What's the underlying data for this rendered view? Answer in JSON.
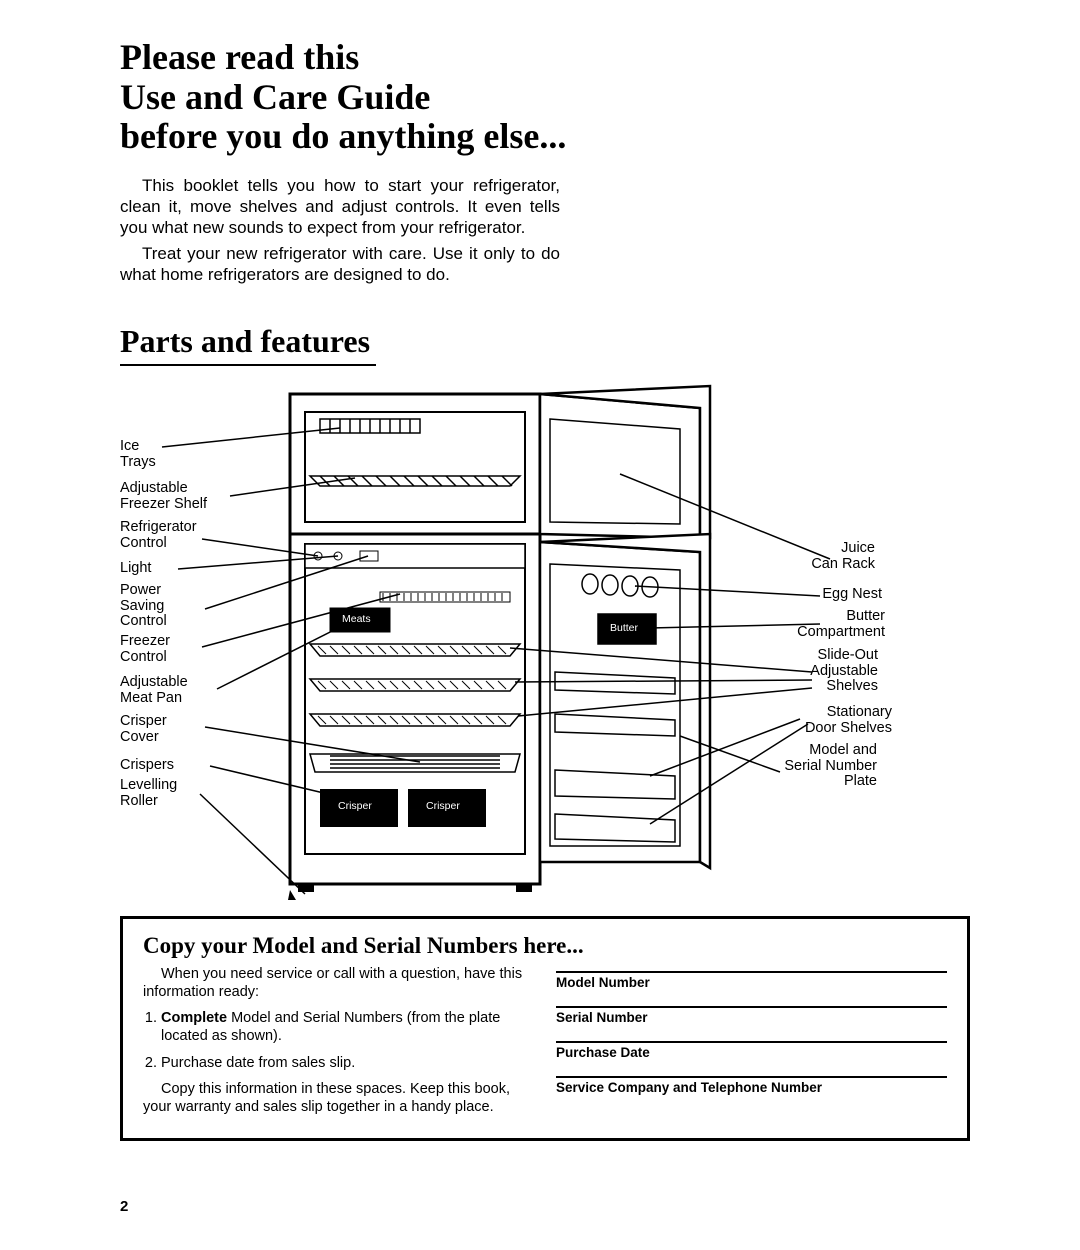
{
  "title_l1": "Please read this",
  "title_l2": "Use and Care Guide",
  "title_l3": "before you do anything else...",
  "intro_p1": "This booklet tells you how to start your refrigerator, clean it, move shelves and adjust controls. It even tells you what new sounds to expect from your refrigerator.",
  "intro_p2": "Treat your new refrigerator with care. Use it only to do what home refrigerators are designed to do.",
  "parts_heading": "Parts and features",
  "labels_left": {
    "ice_trays_l1": "Ice",
    "ice_trays_l2": "Trays",
    "adj_freezer_l1": "Adjustable",
    "adj_freezer_l2": "Freezer Shelf",
    "refrig_ctrl_l1": "Refrigerator",
    "refrig_ctrl_l2": "Control",
    "light": "Light",
    "power_l1": "Power",
    "power_l2": "Saving",
    "power_l3": "Control",
    "freezer_ctrl_l1": "Freezer",
    "freezer_ctrl_l2": "Control",
    "adj_meat_l1": "Adjustable",
    "adj_meat_l2": "Meat Pan",
    "crisper_cover_l1": "Crisper",
    "crisper_cover_l2": "Cover",
    "crispers": "Crispers",
    "roller_l1": "Levelling",
    "roller_l2": "Roller"
  },
  "labels_right": {
    "juice_l1": "Juice",
    "juice_l2": "Can Rack",
    "egg": "Egg Nest",
    "butter_l1": "Butter",
    "butter_l2": "Compartment",
    "slide_l1": "Slide-Out",
    "slide_l2": "Adjustable",
    "slide_l3": "Shelves",
    "stat_l1": "Stationary",
    "stat_l2": "Door Shelves",
    "model_l1": "Model and",
    "model_l2": "Serial Number",
    "model_l3": "Plate"
  },
  "diag_internal": {
    "meats": "Meats",
    "butter": "Butter",
    "crisper": "Crisper",
    "crisper2": "Crisper"
  },
  "form": {
    "heading": "Copy your Model and Serial Numbers here...",
    "p1": "When you need service or call with a question, have this information ready:",
    "li1_bold": "Complete",
    "li1_rest": " Model and Serial Numbers (from the plate located as shown).",
    "li2": "Purchase date from sales slip.",
    "p2": "Copy this information in these spaces. Keep this book, your warranty and sales slip together in a handy place.",
    "f1": "Model Number",
    "f2": "Serial Number",
    "f3": "Purchase Date",
    "f4": "Service Company and Telephone Number"
  },
  "page_number": "2"
}
